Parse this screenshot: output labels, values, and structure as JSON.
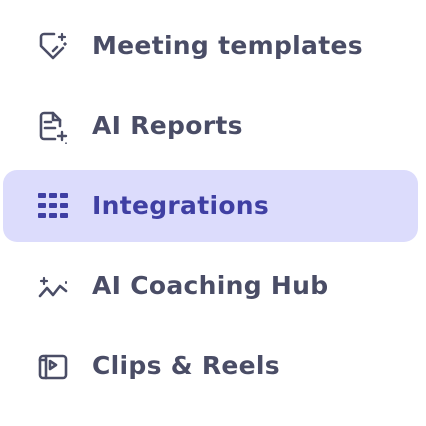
{
  "nav": {
    "items": [
      {
        "label": "Meeting templates",
        "icon": "template-sparkle-icon",
        "active": false
      },
      {
        "label": "AI Reports",
        "icon": "report-sparkle-icon",
        "active": false
      },
      {
        "label": "Integrations",
        "icon": "grid-icon",
        "active": true
      },
      {
        "label": "AI Coaching Hub",
        "icon": "coaching-trend-icon",
        "active": false
      },
      {
        "label": "Clips & Reels",
        "icon": "clips-video-icon",
        "active": false
      }
    ]
  },
  "colors": {
    "text": "#4a4d66",
    "active_text": "#3f3fa3",
    "active_bg": "#dcdcfc"
  }
}
